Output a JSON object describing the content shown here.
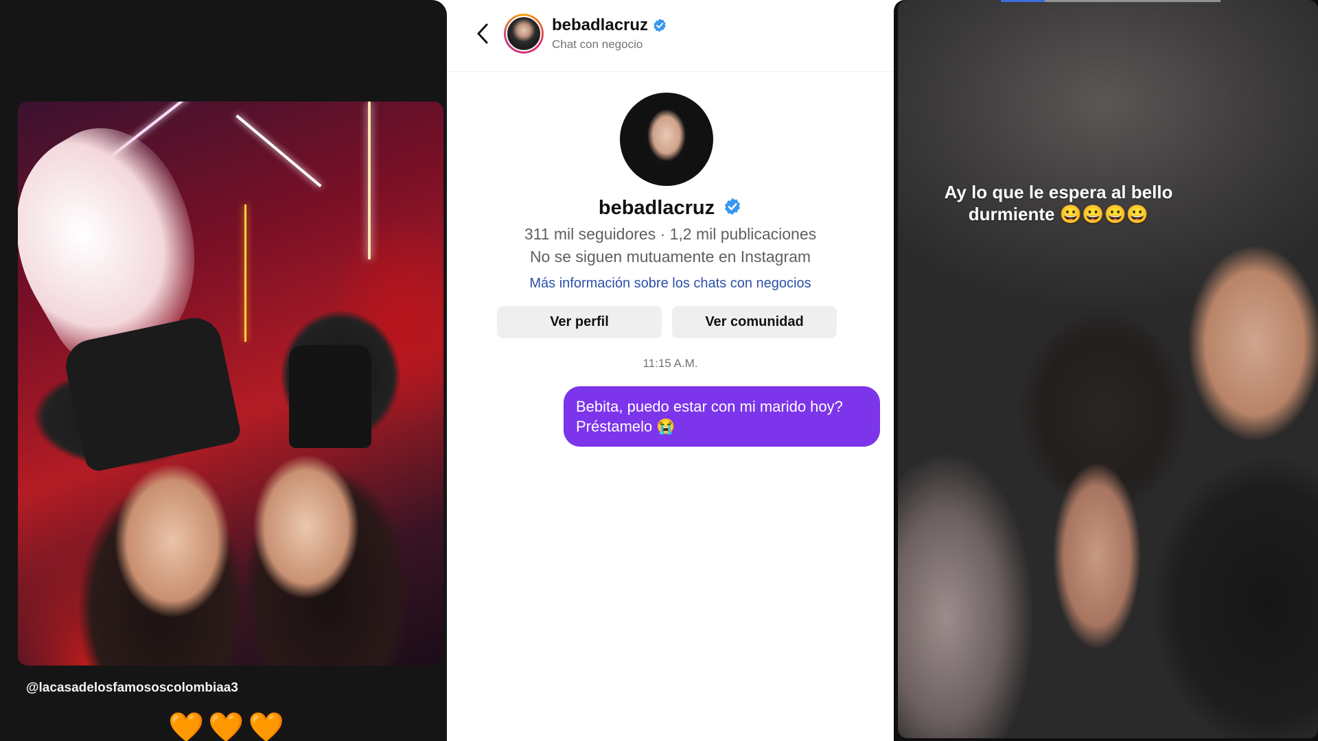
{
  "left_story": {
    "handle": "@lacasadelosfamososcolombiaa3",
    "hearts": "🧡🧡🧡"
  },
  "chat": {
    "header": {
      "username": "bebadlacruz",
      "subtitle": "Chat con negocio"
    },
    "profile": {
      "name": "bebadlacruz",
      "stats": "311 mil seguidores · 1,2 mil publicaciones",
      "mutual": "No se siguen mutuamente en Instagram",
      "info_link": "Más información sobre los chats con negocios",
      "view_profile_label": "Ver perfil",
      "view_community_label": "Ver comunidad"
    },
    "message": {
      "time": "11:15 A.M.",
      "line1": "Bebita, puedo estar con mi marido hoy?",
      "line2": "Préstamelo 😭"
    },
    "colors": {
      "bubble": "#7c35ea",
      "verified": "#3897f0",
      "link": "#2b4fa8"
    }
  },
  "right_story": {
    "caption_line1": "Ay lo que le espera al bello",
    "caption_line2": "durmiente 😀😀😀😀",
    "progress": 0.2
  }
}
